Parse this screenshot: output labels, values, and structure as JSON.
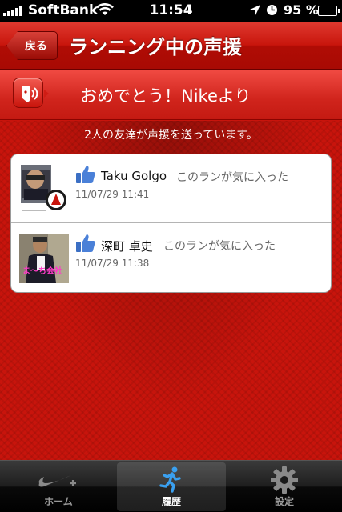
{
  "status_bar": {
    "carrier": "SoftBank",
    "time": "11:54",
    "battery_percent": "95 %",
    "battery_level": 0.95,
    "icons": [
      "signal-icon",
      "wifi-icon",
      "location-icon",
      "alarm-icon",
      "battery-icon"
    ]
  },
  "nav": {
    "back_label": "戻る",
    "title": "ランニング中の声援"
  },
  "banner": {
    "icon": "cheer-speaker-icon",
    "text": "おめでとう！Nikeより"
  },
  "friends_count_text": "2人の友達が声援を送っています。",
  "cheers": [
    {
      "name": "Taku Golgo",
      "message": "このランが気に入った",
      "time": "11/07/29  11:41",
      "icon": "thumbs-up-icon"
    },
    {
      "name": "深町 卓史",
      "message": "このランが気に入った",
      "time": "11/07/29  11:38",
      "icon": "thumbs-up-icon",
      "avatar_caption": "ま〜ち会社"
    }
  ],
  "tabs": [
    {
      "label": "ホーム",
      "icon": "nike-swoosh-icon",
      "selected": false
    },
    {
      "label": "履歴",
      "icon": "runner-icon",
      "selected": true
    },
    {
      "label": "設定",
      "icon": "gear-icon",
      "selected": false
    }
  ],
  "colors": {
    "accent_red": "#c8140c",
    "tab_bar": "#000000",
    "selected_tab_icon": "#2a8ee0"
  }
}
